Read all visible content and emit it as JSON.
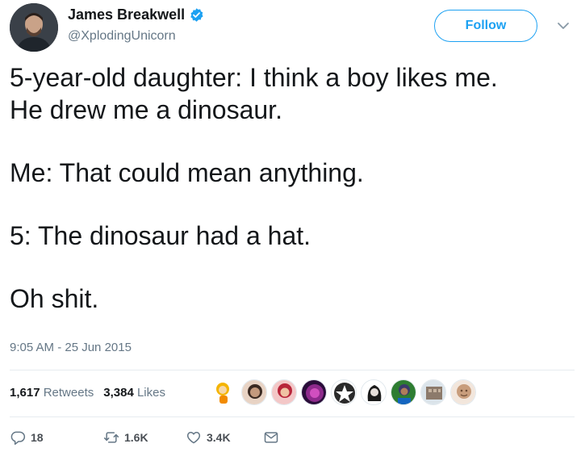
{
  "header": {
    "display_name": "James Breakwell",
    "handle": "@XplodingUnicorn",
    "follow_label": "Follow"
  },
  "tweet": {
    "lines": [
      "5-year-old daughter: I think a boy likes me.",
      "He drew me a dinosaur.",
      "Me: That could mean anything.",
      "5: The dinosaur had a hat.",
      "Oh shit."
    ],
    "timestamp": "9:05 AM - 25 Jun 2015"
  },
  "stats": {
    "retweets_count": "1,617",
    "retweets_label": "Retweets",
    "likes_count": "3,384",
    "likes_label": "Likes"
  },
  "actions": {
    "reply_count": "18",
    "retweet_count": "1.6K",
    "like_count": "3.4K"
  },
  "icons": [
    "verified-badge-icon",
    "chevron-down-icon",
    "reply-icon",
    "retweet-icon",
    "heart-icon",
    "message-icon"
  ],
  "colors": {
    "accent": "#1da1f2",
    "text": "#14171a",
    "muted": "#657786",
    "divider": "#e6ecf0"
  }
}
